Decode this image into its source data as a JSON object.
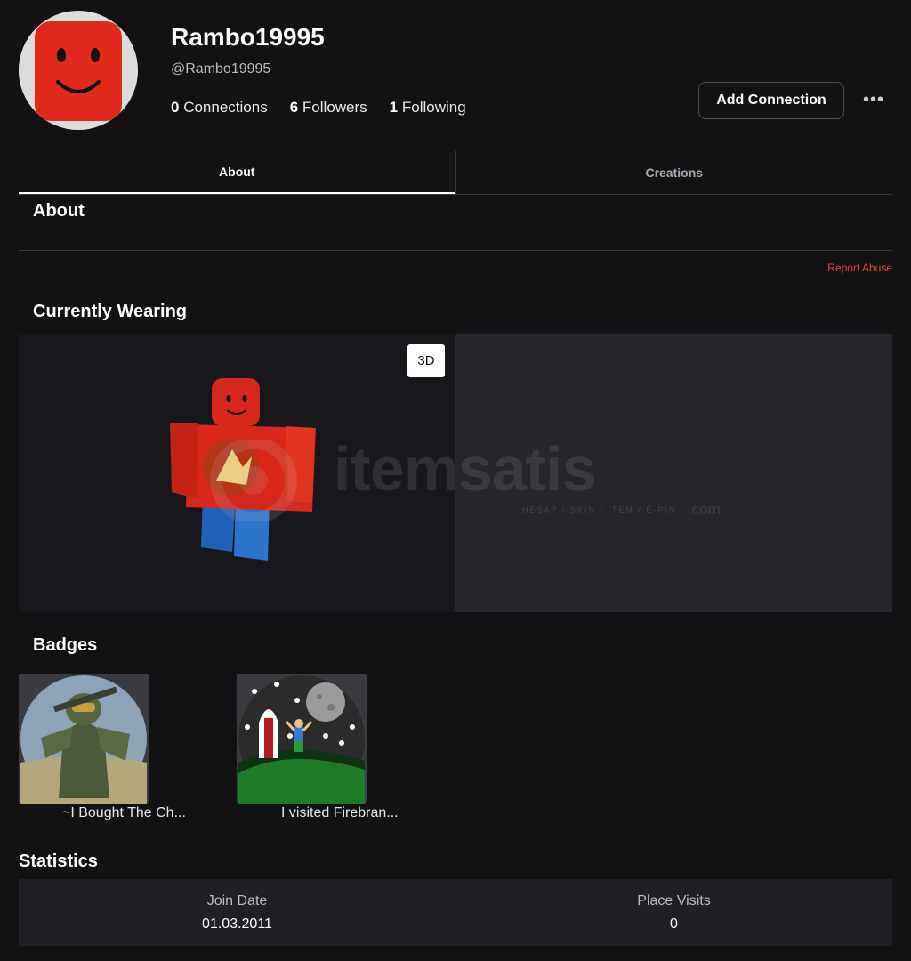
{
  "profile": {
    "display_name": "Rambo19995",
    "username": "@Rambo19995",
    "connections_count": "0",
    "connections_label": "Connections",
    "followers_count": "6",
    "followers_label": "Followers",
    "following_count": "1",
    "following_label": "Following",
    "add_connection_label": "Add Connection",
    "more_label": "•••"
  },
  "tabs": [
    {
      "label": "About",
      "active": true
    },
    {
      "label": "Creations",
      "active": false
    }
  ],
  "about": {
    "heading": "About",
    "report_label": "Report Abuse"
  },
  "wearing": {
    "heading": "Currently Wearing",
    "view_3d_label": "3D"
  },
  "watermark": {
    "brand": "itemsatis",
    "tagline": "HESAP / SKIN / ITEM / E-PIN",
    "suffix": ".com"
  },
  "badges": {
    "heading": "Badges",
    "items": [
      {
        "label": "~I Bought The Ch..."
      },
      {
        "label": "I visited Firebran..."
      }
    ]
  },
  "statistics": {
    "heading": "Statistics",
    "join_date_label": "Join Date",
    "join_date_value": "01.03.2011",
    "place_visits_label": "Place Visits",
    "place_visits_value": "0"
  },
  "colors": {
    "background": "#121215",
    "panel": "#1f2024",
    "report": "#e0453a",
    "avatar_red": "#e02b1c"
  }
}
